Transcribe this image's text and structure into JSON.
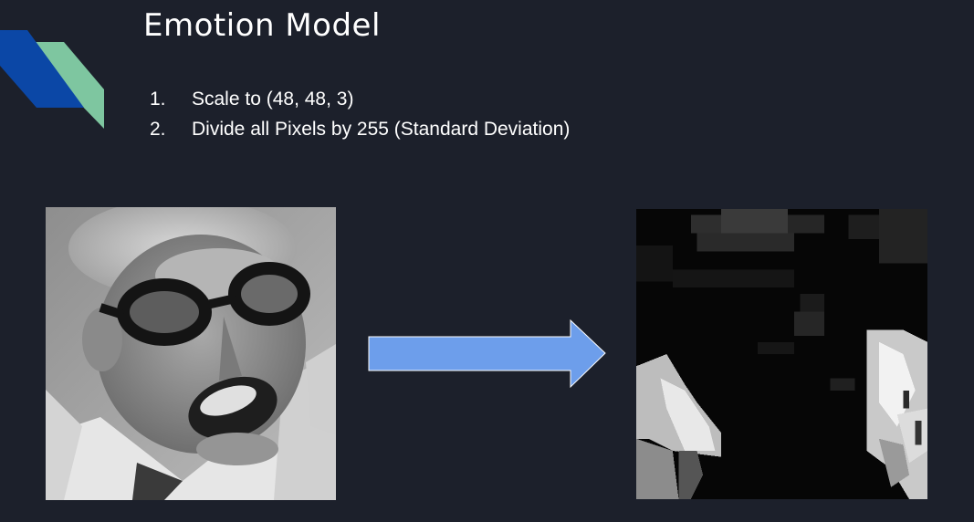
{
  "slide": {
    "title": "Emotion Model",
    "steps": [
      {
        "num": "1.",
        "text": "Scale to (48, 48, 3)"
      },
      {
        "num": "2.",
        "text": "Divide all Pixels by 255 (Standard Deviation)"
      }
    ]
  },
  "colors": {
    "background": "#1c202b",
    "accent_blue": "#0b47a6",
    "accent_green": "#7ec6a0",
    "arrow_fill": "#6d9eeb"
  },
  "images": {
    "original": "grayscale face photo of a shouting man wearing glasses",
    "processed": "pixelated dark normalized 48x48 version of the face"
  }
}
